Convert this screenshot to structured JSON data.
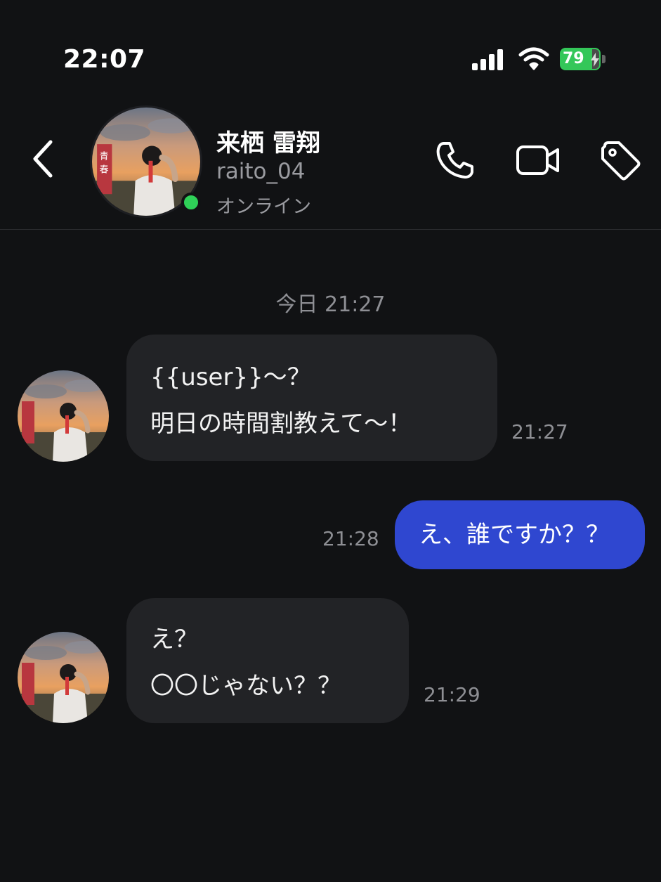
{
  "status_bar": {
    "time": "22:07",
    "battery": "79",
    "battery_color": "#34c759"
  },
  "header": {
    "contact_name": "来栖 雷翔",
    "username": "raito_04",
    "status": "オンライン",
    "online_color": "#2fd158",
    "icons": [
      "back-icon",
      "phone-icon",
      "video-icon",
      "tag-icon"
    ]
  },
  "chat": {
    "date_separator": "今日 21:27",
    "messages": [
      {
        "direction": "incoming",
        "lines": [
          "{{user}}〜？",
          "明日の時間割教えて〜！"
        ],
        "time": "21:27"
      },
      {
        "direction": "outgoing",
        "lines": [
          "え、誰ですか？？"
        ],
        "time": "21:28"
      },
      {
        "direction": "incoming",
        "lines": [
          "え？",
          "〇〇じゃない？？"
        ],
        "time": "21:29"
      }
    ]
  },
  "colors": {
    "background": "#111214",
    "incoming_bubble": "#222326",
    "outgoing_bubble": "#2f47d0"
  }
}
